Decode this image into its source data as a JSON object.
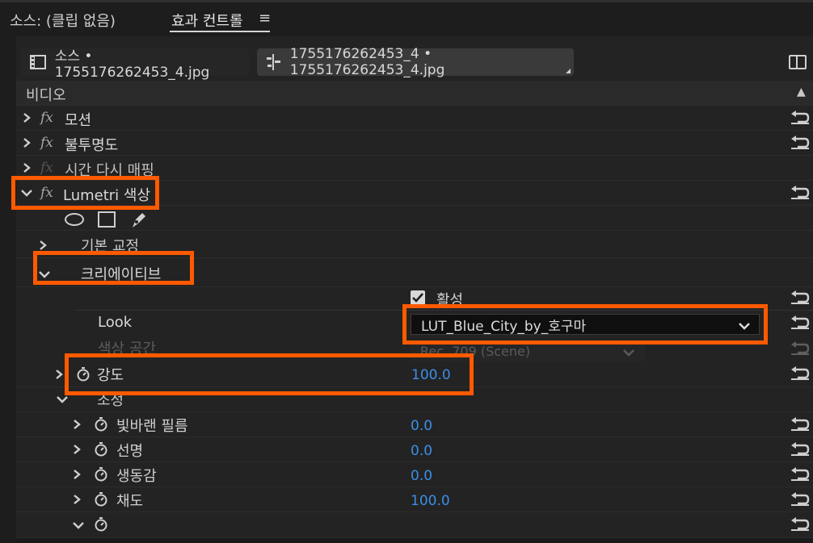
{
  "header": {
    "source_label": "소스: (클립 없음)",
    "effect_controls_tab": "효과 컨트롤",
    "menu_icon": "≡"
  },
  "clip_bar": {
    "source_chip": "소스 • 1755176262453_4.jpg",
    "sequence_chip": "1755176262453_4 • 1755176262453_4.jpg",
    "source_icon": "film-icon",
    "sequence_icon": "sequence-icon",
    "panel_toggle_icon": "panel-toggle-icon"
  },
  "section": {
    "video": "비디오"
  },
  "effects": [
    {
      "label": "모션",
      "fx": "fx"
    },
    {
      "label": "불투명도",
      "fx": "fx"
    },
    {
      "label": "시간 다시 매핑",
      "fx": "fx"
    },
    {
      "label": "Lumetri 색상",
      "fx": "fx"
    }
  ],
  "lumetri": {
    "subsections": {
      "basic": "기본 교정",
      "creative": "크리에이티브"
    },
    "enable_label": "활성",
    "enable_checked": true,
    "look_label": "Look",
    "look_value": "LUT_Blue_City_by_호구마",
    "color_space_label": "색상 공간",
    "color_space_value": "Rec. 709 (Scene)",
    "intensity_label": "강도",
    "intensity_value": "100.0",
    "adjust_label": "조정",
    "params": [
      {
        "label": "빛바랜 필름",
        "value": "0.0"
      },
      {
        "label": "선명",
        "value": "0.0"
      },
      {
        "label": "생동감",
        "value": "0.0"
      },
      {
        "label": "채도",
        "value": "100.0"
      },
      {
        "label": "",
        "value": ""
      }
    ]
  },
  "colors": {
    "highlight": "#ff5a00",
    "value_blue": "#3b8ee8",
    "background": "#232323"
  }
}
